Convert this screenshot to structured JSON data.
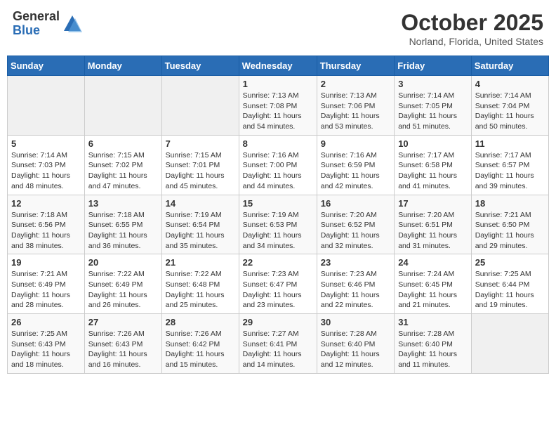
{
  "logo": {
    "general": "General",
    "blue": "Blue"
  },
  "title": {
    "month": "October 2025",
    "location": "Norland, Florida, United States"
  },
  "weekdays": [
    "Sunday",
    "Monday",
    "Tuesday",
    "Wednesday",
    "Thursday",
    "Friday",
    "Saturday"
  ],
  "weeks": [
    [
      {
        "day": null,
        "sunrise": null,
        "sunset": null,
        "daylight": null
      },
      {
        "day": null,
        "sunrise": null,
        "sunset": null,
        "daylight": null
      },
      {
        "day": null,
        "sunrise": null,
        "sunset": null,
        "daylight": null
      },
      {
        "day": "1",
        "sunrise": "Sunrise: 7:13 AM",
        "sunset": "Sunset: 7:08 PM",
        "daylight": "Daylight: 11 hours and 54 minutes."
      },
      {
        "day": "2",
        "sunrise": "Sunrise: 7:13 AM",
        "sunset": "Sunset: 7:06 PM",
        "daylight": "Daylight: 11 hours and 53 minutes."
      },
      {
        "day": "3",
        "sunrise": "Sunrise: 7:14 AM",
        "sunset": "Sunset: 7:05 PM",
        "daylight": "Daylight: 11 hours and 51 minutes."
      },
      {
        "day": "4",
        "sunrise": "Sunrise: 7:14 AM",
        "sunset": "Sunset: 7:04 PM",
        "daylight": "Daylight: 11 hours and 50 minutes."
      }
    ],
    [
      {
        "day": "5",
        "sunrise": "Sunrise: 7:14 AM",
        "sunset": "Sunset: 7:03 PM",
        "daylight": "Daylight: 11 hours and 48 minutes."
      },
      {
        "day": "6",
        "sunrise": "Sunrise: 7:15 AM",
        "sunset": "Sunset: 7:02 PM",
        "daylight": "Daylight: 11 hours and 47 minutes."
      },
      {
        "day": "7",
        "sunrise": "Sunrise: 7:15 AM",
        "sunset": "Sunset: 7:01 PM",
        "daylight": "Daylight: 11 hours and 45 minutes."
      },
      {
        "day": "8",
        "sunrise": "Sunrise: 7:16 AM",
        "sunset": "Sunset: 7:00 PM",
        "daylight": "Daylight: 11 hours and 44 minutes."
      },
      {
        "day": "9",
        "sunrise": "Sunrise: 7:16 AM",
        "sunset": "Sunset: 6:59 PM",
        "daylight": "Daylight: 11 hours and 42 minutes."
      },
      {
        "day": "10",
        "sunrise": "Sunrise: 7:17 AM",
        "sunset": "Sunset: 6:58 PM",
        "daylight": "Daylight: 11 hours and 41 minutes."
      },
      {
        "day": "11",
        "sunrise": "Sunrise: 7:17 AM",
        "sunset": "Sunset: 6:57 PM",
        "daylight": "Daylight: 11 hours and 39 minutes."
      }
    ],
    [
      {
        "day": "12",
        "sunrise": "Sunrise: 7:18 AM",
        "sunset": "Sunset: 6:56 PM",
        "daylight": "Daylight: 11 hours and 38 minutes."
      },
      {
        "day": "13",
        "sunrise": "Sunrise: 7:18 AM",
        "sunset": "Sunset: 6:55 PM",
        "daylight": "Daylight: 11 hours and 36 minutes."
      },
      {
        "day": "14",
        "sunrise": "Sunrise: 7:19 AM",
        "sunset": "Sunset: 6:54 PM",
        "daylight": "Daylight: 11 hours and 35 minutes."
      },
      {
        "day": "15",
        "sunrise": "Sunrise: 7:19 AM",
        "sunset": "Sunset: 6:53 PM",
        "daylight": "Daylight: 11 hours and 34 minutes."
      },
      {
        "day": "16",
        "sunrise": "Sunrise: 7:20 AM",
        "sunset": "Sunset: 6:52 PM",
        "daylight": "Daylight: 11 hours and 32 minutes."
      },
      {
        "day": "17",
        "sunrise": "Sunrise: 7:20 AM",
        "sunset": "Sunset: 6:51 PM",
        "daylight": "Daylight: 11 hours and 31 minutes."
      },
      {
        "day": "18",
        "sunrise": "Sunrise: 7:21 AM",
        "sunset": "Sunset: 6:50 PM",
        "daylight": "Daylight: 11 hours and 29 minutes."
      }
    ],
    [
      {
        "day": "19",
        "sunrise": "Sunrise: 7:21 AM",
        "sunset": "Sunset: 6:49 PM",
        "daylight": "Daylight: 11 hours and 28 minutes."
      },
      {
        "day": "20",
        "sunrise": "Sunrise: 7:22 AM",
        "sunset": "Sunset: 6:49 PM",
        "daylight": "Daylight: 11 hours and 26 minutes."
      },
      {
        "day": "21",
        "sunrise": "Sunrise: 7:22 AM",
        "sunset": "Sunset: 6:48 PM",
        "daylight": "Daylight: 11 hours and 25 minutes."
      },
      {
        "day": "22",
        "sunrise": "Sunrise: 7:23 AM",
        "sunset": "Sunset: 6:47 PM",
        "daylight": "Daylight: 11 hours and 23 minutes."
      },
      {
        "day": "23",
        "sunrise": "Sunrise: 7:23 AM",
        "sunset": "Sunset: 6:46 PM",
        "daylight": "Daylight: 11 hours and 22 minutes."
      },
      {
        "day": "24",
        "sunrise": "Sunrise: 7:24 AM",
        "sunset": "Sunset: 6:45 PM",
        "daylight": "Daylight: 11 hours and 21 minutes."
      },
      {
        "day": "25",
        "sunrise": "Sunrise: 7:25 AM",
        "sunset": "Sunset: 6:44 PM",
        "daylight": "Daylight: 11 hours and 19 minutes."
      }
    ],
    [
      {
        "day": "26",
        "sunrise": "Sunrise: 7:25 AM",
        "sunset": "Sunset: 6:43 PM",
        "daylight": "Daylight: 11 hours and 18 minutes."
      },
      {
        "day": "27",
        "sunrise": "Sunrise: 7:26 AM",
        "sunset": "Sunset: 6:43 PM",
        "daylight": "Daylight: 11 hours and 16 minutes."
      },
      {
        "day": "28",
        "sunrise": "Sunrise: 7:26 AM",
        "sunset": "Sunset: 6:42 PM",
        "daylight": "Daylight: 11 hours and 15 minutes."
      },
      {
        "day": "29",
        "sunrise": "Sunrise: 7:27 AM",
        "sunset": "Sunset: 6:41 PM",
        "daylight": "Daylight: 11 hours and 14 minutes."
      },
      {
        "day": "30",
        "sunrise": "Sunrise: 7:28 AM",
        "sunset": "Sunset: 6:40 PM",
        "daylight": "Daylight: 11 hours and 12 minutes."
      },
      {
        "day": "31",
        "sunrise": "Sunrise: 7:28 AM",
        "sunset": "Sunset: 6:40 PM",
        "daylight": "Daylight: 11 hours and 11 minutes."
      },
      {
        "day": null,
        "sunrise": null,
        "sunset": null,
        "daylight": null
      }
    ]
  ]
}
